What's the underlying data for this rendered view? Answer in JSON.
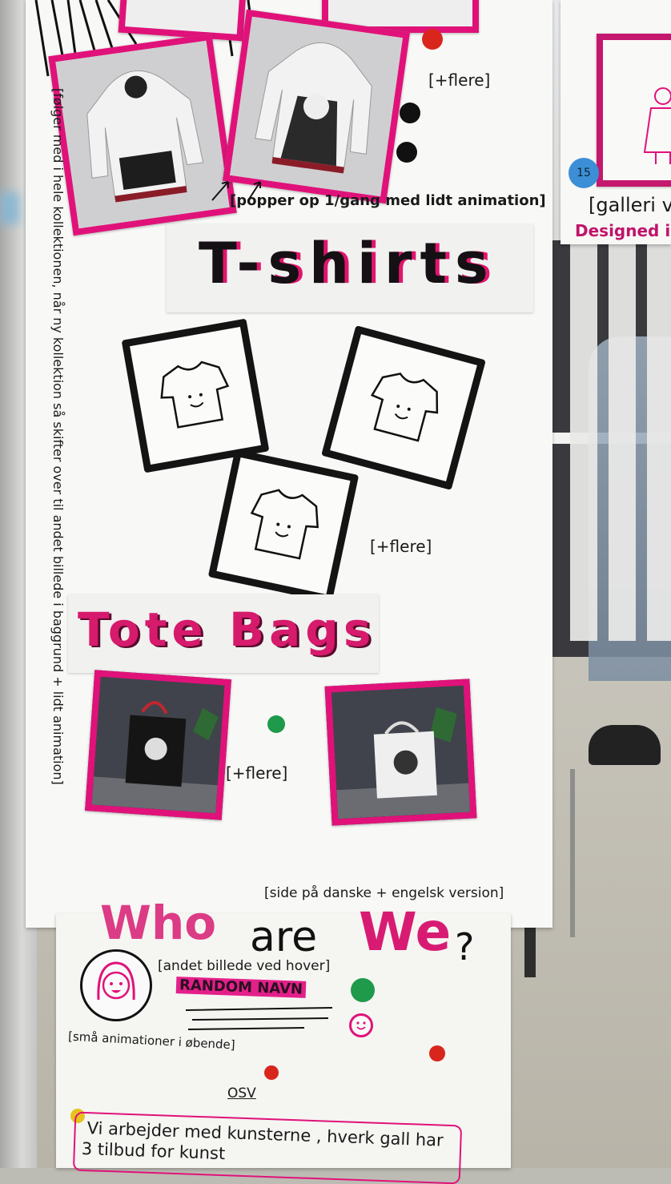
{
  "top_notes": {
    "more": "[+flere]",
    "popup": "[popper op 1/gang med lidt animation]",
    "gallery": "[galleri v",
    "designed": "Designed i",
    "badge": "15"
  },
  "side_note": "[følger med i hele kollektionen, når ny kollektion så skifter over til andet billede i baggrund + lidt animation]",
  "tshirts": {
    "title": "T-shirts",
    "more": "[+flere]"
  },
  "totebags": {
    "title": "Tote Bags",
    "more": "[+flere]"
  },
  "site_note": "[side på danske + engelsk version]",
  "who": {
    "word1": "Who",
    "word2": "are",
    "word3": "We",
    "qmark": "?",
    "hover_note": "[andet billede ved hover]",
    "name": "RANDOM NAVN",
    "anim_note": "[små animationer i øbende]",
    "etc": "OSV"
  },
  "bottom_text": {
    "line1": "Vi arbejder med kunsterne , hverk gall har",
    "line2": "3 tilbud for kunst"
  },
  "colors": {
    "pink": "#e0127a",
    "black": "#141414",
    "green_dot": "#1e9a4a",
    "red_dot": "#d8261d",
    "yellow_dot": "#e6c21c",
    "blue_badge": "#3c8fd6"
  }
}
